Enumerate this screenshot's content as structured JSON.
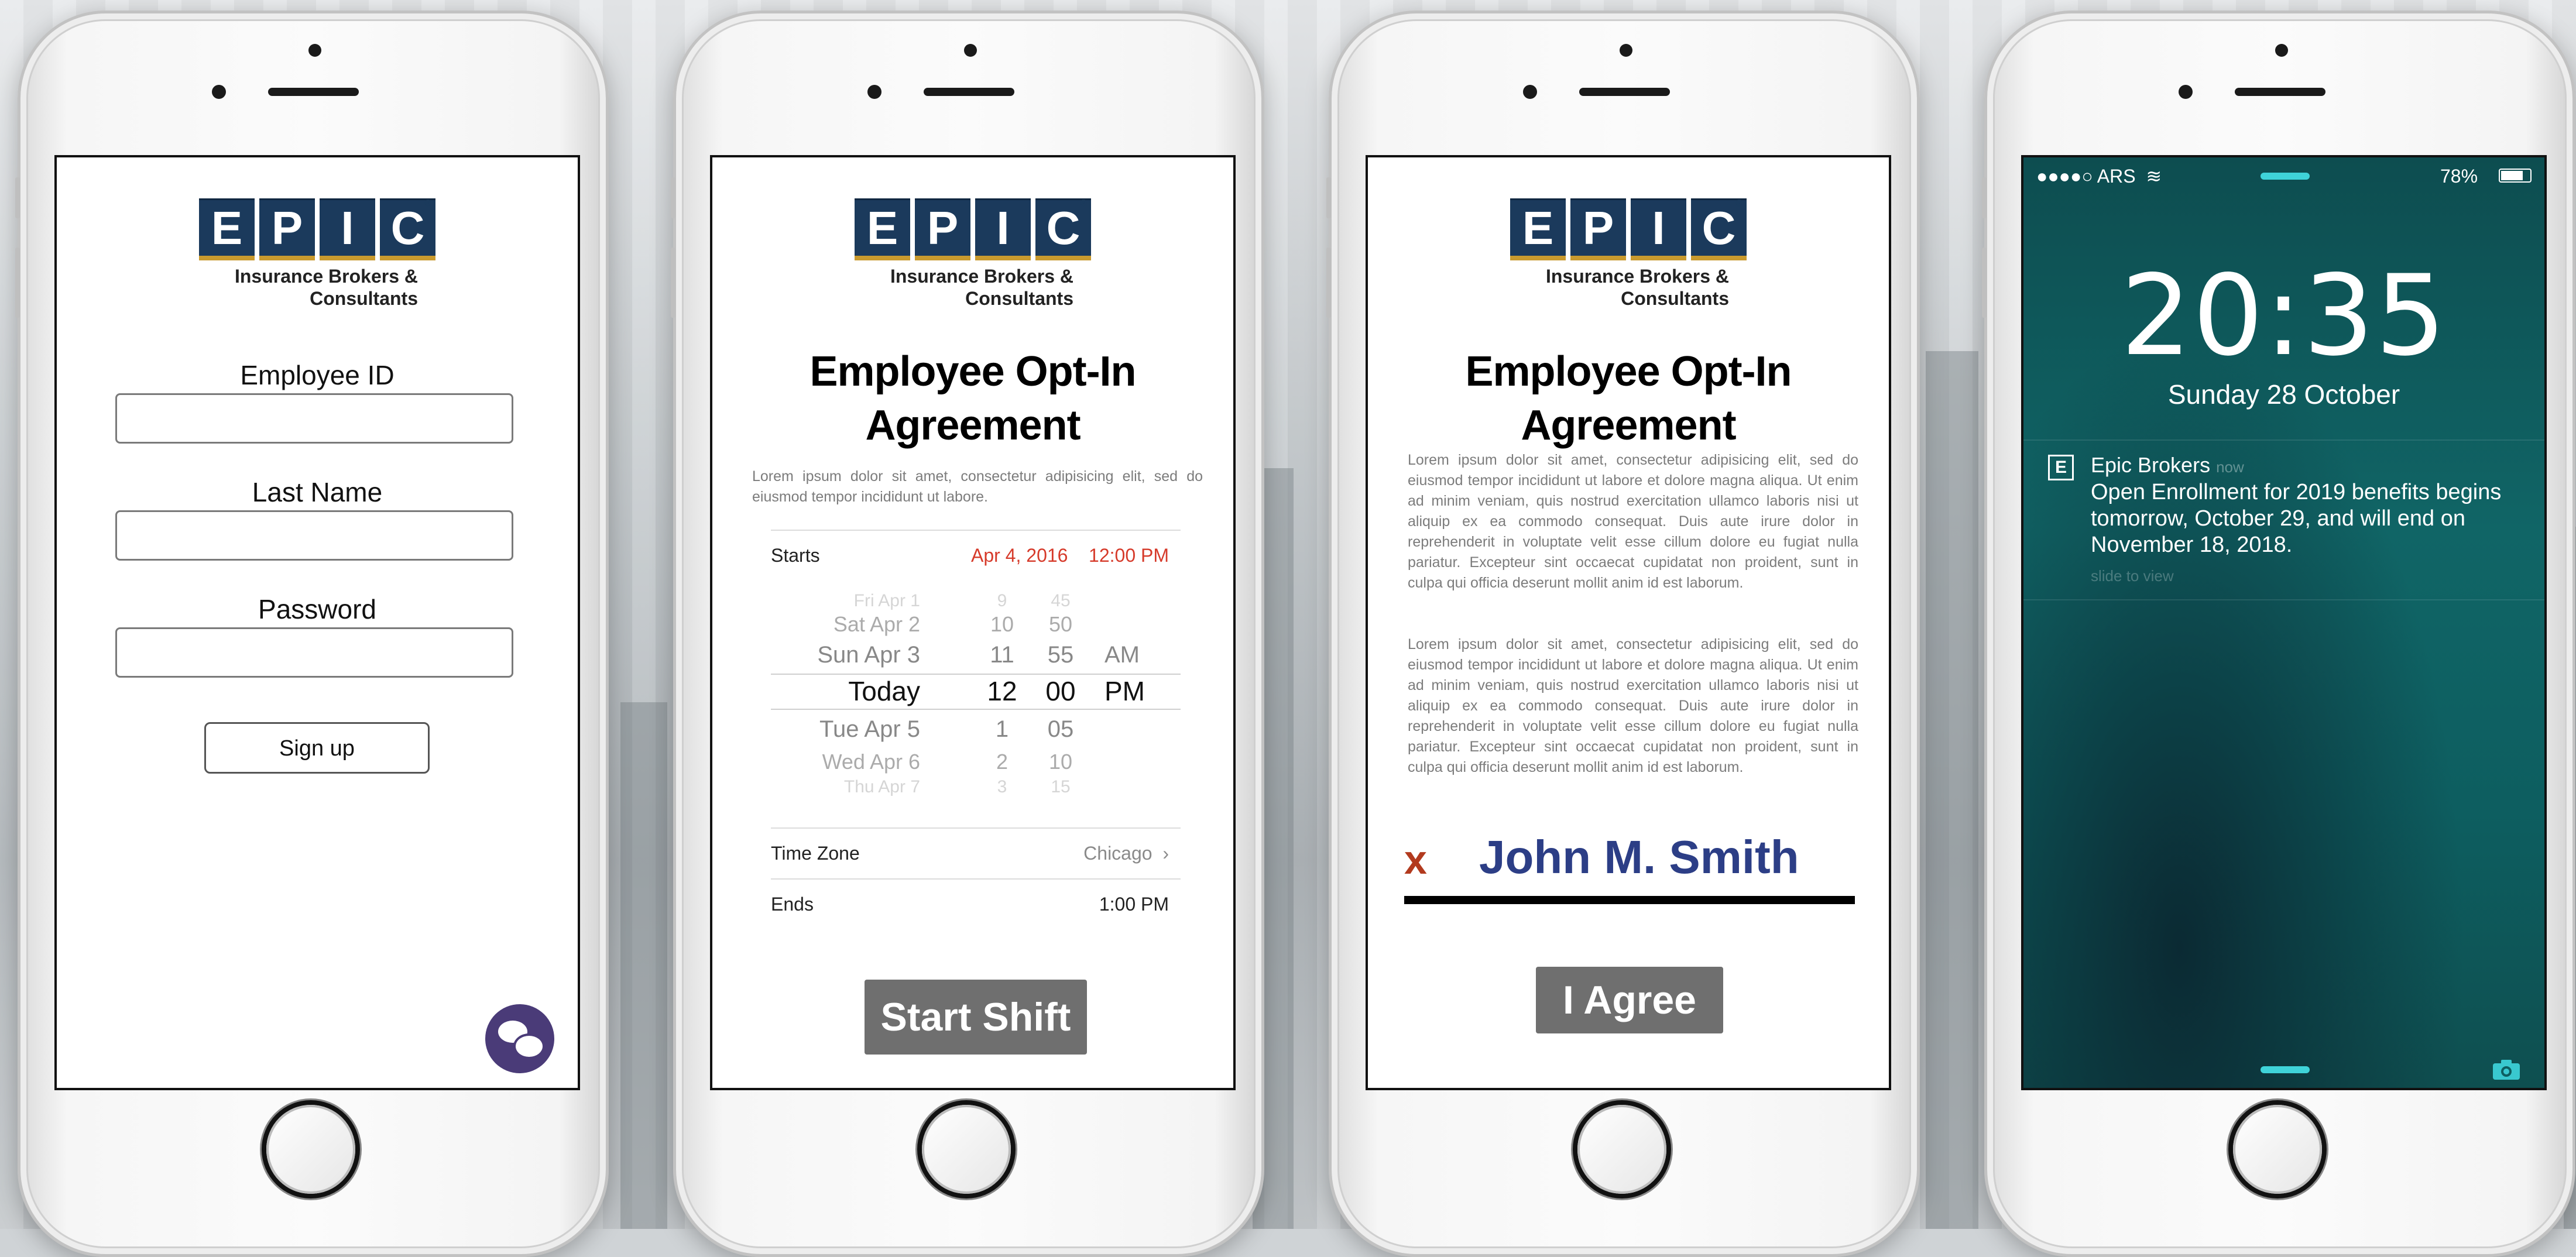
{
  "logo": {
    "letters": [
      "E",
      "P",
      "I",
      "C"
    ],
    "tagline_line1": "Insurance Brokers &",
    "tagline_line2": "Consultants"
  },
  "login": {
    "employee_id_label": "Employee ID",
    "last_name_label": "Last Name",
    "password_label": "Password",
    "signup_label": "Sign up",
    "chat_icon": "chat-bubbles-icon"
  },
  "optin": {
    "title_line1": "Employee Opt-In",
    "title_line2": "Agreement",
    "intro": "Lorem ipsum dolor sit amet, consectetur adipisicing elit, sed do eiusmod tempor incididunt ut labore.",
    "starts_label": "Starts",
    "starts_date": "Apr 4, 2016",
    "starts_time": "12:00 PM",
    "picker_rows": [
      {
        "day": "Fri Apr 1",
        "hour": "9",
        "minute": "45",
        "ampm": ""
      },
      {
        "day": "Sat Apr 2",
        "hour": "10",
        "minute": "50",
        "ampm": ""
      },
      {
        "day": "Sun Apr 3",
        "hour": "11",
        "minute": "55",
        "ampm": "AM"
      },
      {
        "day": "Today",
        "hour": "12",
        "minute": "00",
        "ampm": "PM"
      },
      {
        "day": "Tue Apr 5",
        "hour": "1",
        "minute": "05",
        "ampm": ""
      },
      {
        "day": "Wed Apr 6",
        "hour": "2",
        "minute": "10",
        "ampm": ""
      },
      {
        "day": "Thu Apr 7",
        "hour": "3",
        "minute": "15",
        "ampm": ""
      }
    ],
    "timezone_label": "Time Zone",
    "timezone_value": "Chicago",
    "ends_label": "Ends",
    "ends_value": "1:00 PM",
    "start_shift_label": "Start Shift"
  },
  "agreement": {
    "title_line1": "Employee Opt-In",
    "title_line2": "Agreement",
    "paragraph1": "Lorem ipsum dolor sit amet, consectetur adipisicing elit, sed do eiusmod tempor incididunt ut labore et dolore magna aliqua. Ut enim ad minim veniam, quis nostrud exercitation ullamco laboris nisi ut aliquip ex ea commodo consequat. Duis aute irure dolor in reprehenderit in voluptate velit esse cillum dolore eu fugiat nulla pariatur. Excepteur sint occaecat cupidatat non proident, sunt in culpa qui officia deserunt mollit anim id est laborum.",
    "paragraph2": "Lorem ipsum dolor sit amet, consectetur adipisicing elit, sed do eiusmod tempor incididunt ut labore et dolore magna aliqua. Ut enim ad minim veniam, quis nostrud exercitation ullamco laboris nisi ut aliquip ex ea commodo consequat. Duis aute irure dolor in reprehenderit in voluptate velit esse cillum dolore eu fugiat nulla pariatur. Excepteur sint occaecat cupidatat non proident, sunt in culpa qui officia deserunt mollit anim id est laborum.",
    "signature_mark": "x",
    "signature_name": "John M. Smith",
    "agree_label": "I Agree"
  },
  "lockscreen": {
    "carrier": "●●●●○ ARS",
    "battery": "78%",
    "battery_level": 0.78,
    "time": "20:35",
    "date": "Sunday 28 October",
    "notification": {
      "app_initial": "E",
      "app_name": "Epic Brokers",
      "age": "now",
      "body": "Open Enrollment for 2019 benefits begins tomorrow, October 29, and will end on November 18, 2018.",
      "hint": "slide to view"
    }
  },
  "colors": {
    "logo_blue": "#1b3a5c",
    "logo_gold": "#c99a2e",
    "accent_red": "#d63a2a",
    "signature_blue": "#2c3e86",
    "chat_purple": "#4a3b78",
    "lock_teal": "#106566",
    "button_grey": "#6f6f6f"
  }
}
